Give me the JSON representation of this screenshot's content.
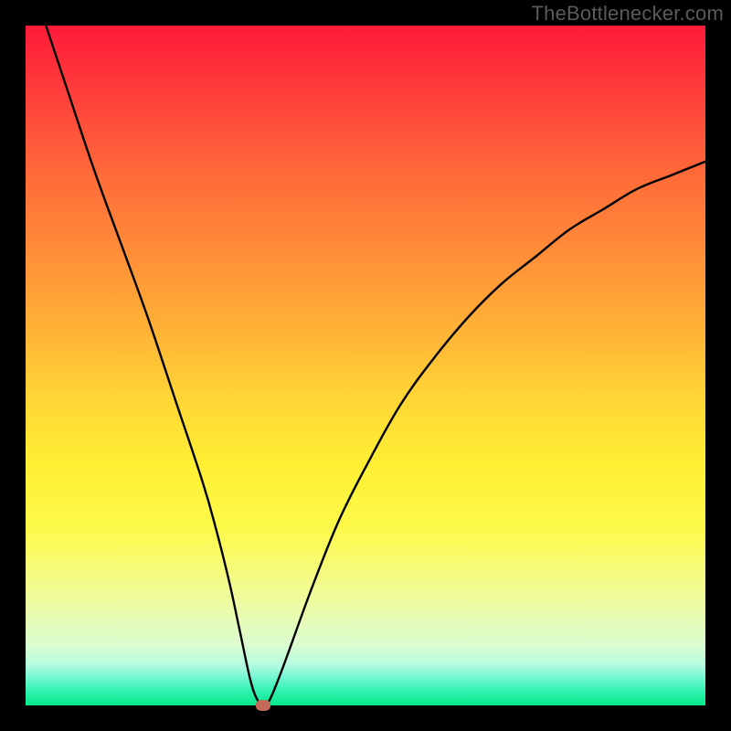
{
  "attribution": "TheBottlenecker.com",
  "colors": {
    "frame": "#000000",
    "gradient_top": "#ff1a3a",
    "gradient_mid": "#ffd635",
    "gradient_bottom": "#06e989",
    "curve": "#000000",
    "dot": "#c46a5a",
    "watermark": "#5a5a5a"
  },
  "chart_data": {
    "type": "line",
    "title": "",
    "xlabel": "",
    "ylabel": "",
    "xlim": [
      0,
      100
    ],
    "ylim": [
      0,
      100
    ],
    "grid": false,
    "legend": false,
    "series": [
      {
        "name": "bottleneck-curve",
        "x": [
          3,
          6,
          10,
          14,
          18,
          22,
          26,
          28,
          30,
          31.5,
          33,
          34,
          35,
          36,
          38,
          42,
          46,
          50,
          55,
          60,
          65,
          70,
          75,
          80,
          85,
          90,
          95,
          100
        ],
        "y": [
          100,
          91,
          79,
          68,
          57,
          45,
          33,
          26,
          18,
          11,
          4,
          1,
          0,
          1,
          6,
          17,
          27,
          35,
          44,
          51,
          57,
          62,
          66,
          70,
          73,
          76,
          78,
          80
        ]
      }
    ],
    "annotations": [
      {
        "name": "min-marker",
        "x": 35,
        "y": 0
      }
    ],
    "gradient_stops_pct": [
      0,
      10,
      22,
      34,
      45,
      55,
      65,
      74,
      80,
      86,
      91,
      94,
      96,
      98,
      100
    ]
  }
}
